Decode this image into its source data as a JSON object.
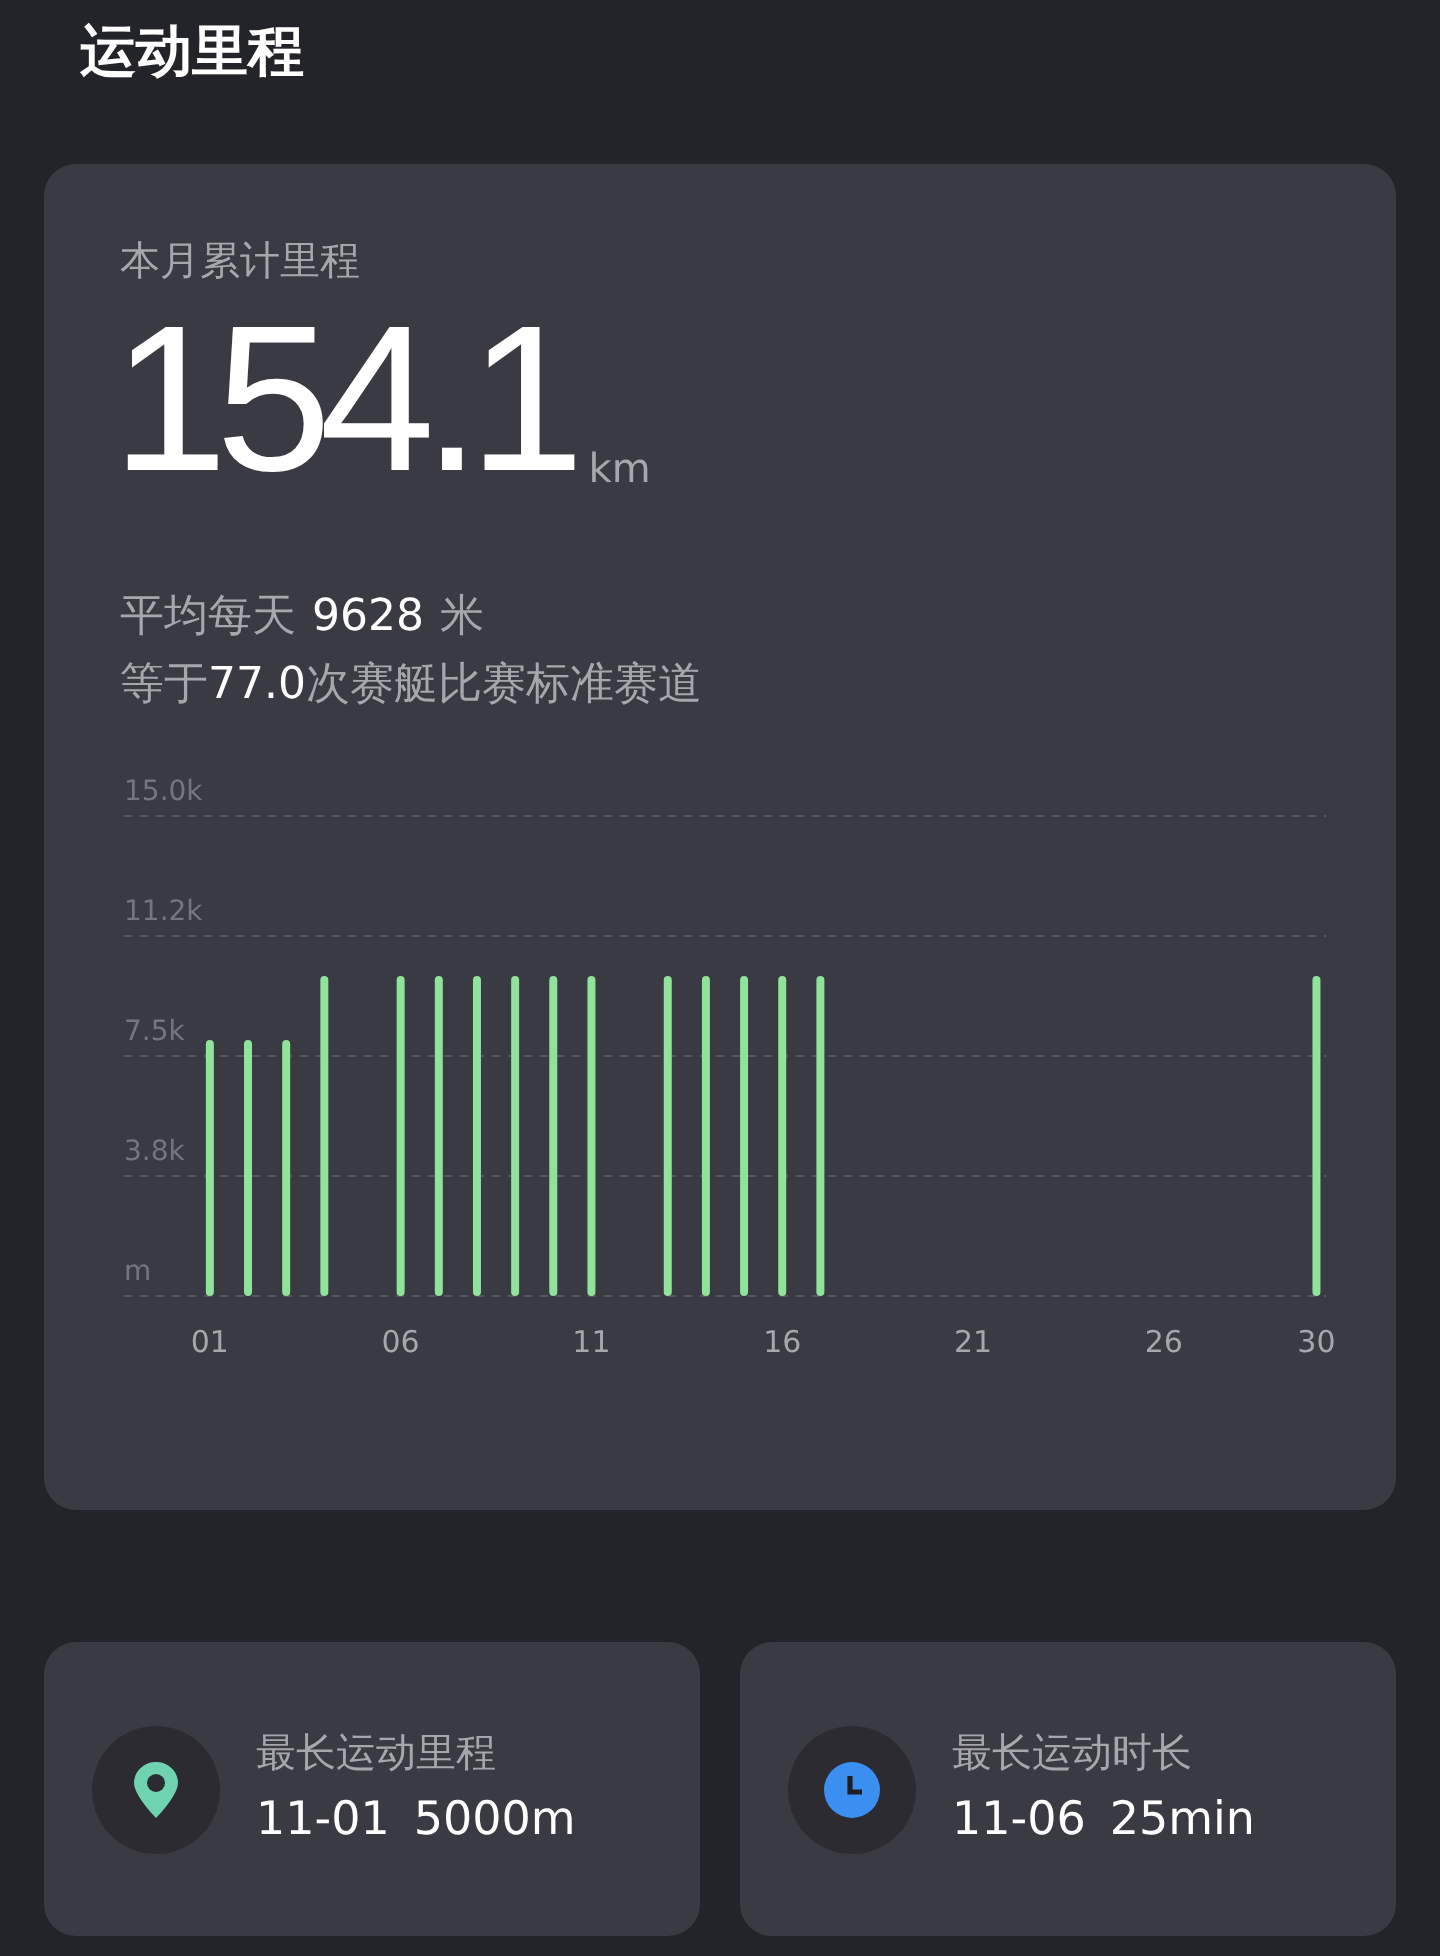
{
  "page_title": "运动里程",
  "summary": {
    "label": "本月累计里程",
    "total": "154.1",
    "unit": "km",
    "average": {
      "prefix": "平均每天",
      "value": "9628",
      "suffix": "米"
    },
    "equivalent": {
      "prefix": "等于",
      "value": "77.0",
      "suffix": "次赛艇比赛标准赛道"
    },
    "chart_data": {
      "type": "bar",
      "grid": true,
      "x": [
        1,
        2,
        3,
        4,
        6,
        7,
        8,
        9,
        10,
        11,
        13,
        14,
        15,
        16,
        17,
        30
      ],
      "series": [
        {
          "color": "#8fe39a",
          "values": [
            8000,
            8000,
            8000,
            10000,
            10000,
            10000,
            10000,
            10000,
            10000,
            10000,
            10000,
            10000,
            10000,
            10000,
            10000,
            10000
          ]
        }
      ],
      "ylim": [
        0,
        15000
      ],
      "yticks": [
        {
          "value": 0,
          "label": "m"
        },
        {
          "value": 3750,
          "label": "3.8k"
        },
        {
          "value": 7500,
          "label": "7.5k"
        },
        {
          "value": 11250,
          "label": "11.2k"
        },
        {
          "value": 15000,
          "label": "15.0k"
        }
      ],
      "xlim": [
        -1.25,
        30.25
      ],
      "xticks": [
        {
          "value": 1,
          "label": "01"
        },
        {
          "value": 6,
          "label": "06"
        },
        {
          "value": 11,
          "label": "11"
        },
        {
          "value": 16,
          "label": "16"
        },
        {
          "value": 21,
          "label": "21"
        },
        {
          "value": 26,
          "label": "26"
        },
        {
          "value": 30,
          "label": "30"
        }
      ]
    }
  },
  "records": [
    {
      "kind": "distance",
      "label": "最长运动里程",
      "date": "11-01",
      "value": "5000m",
      "color": "#6fd3b2"
    },
    {
      "kind": "duration",
      "label": "最长运动时长",
      "date": "11-06",
      "value": "25min",
      "color": "#3b8ff0"
    }
  ]
}
